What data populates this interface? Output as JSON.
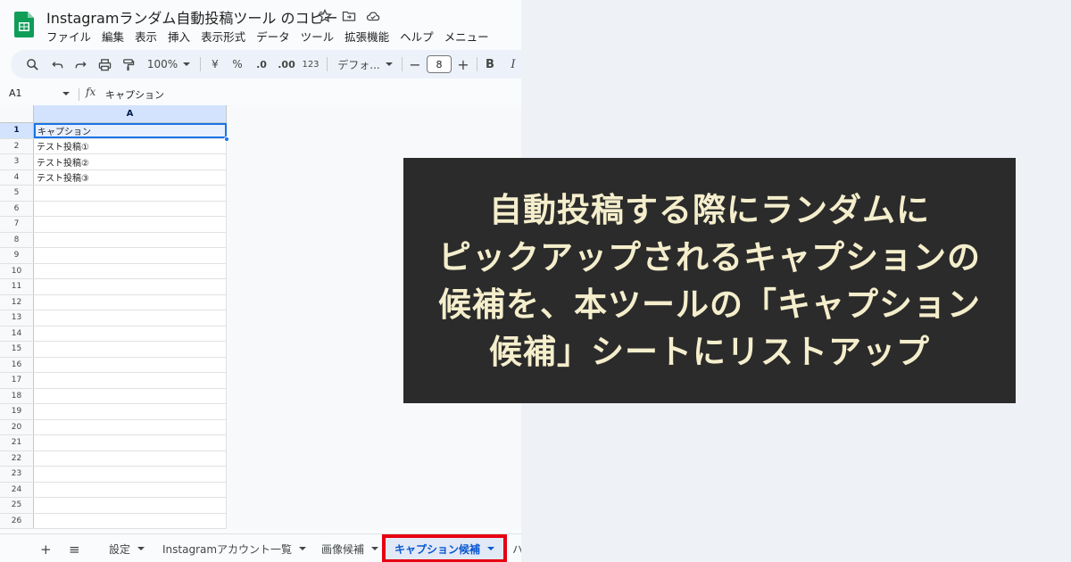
{
  "colors": {
    "accent_blue": "#1a73e8",
    "active_tab_text": "#0b57d0",
    "highlight_red": "#e60012",
    "panel_bg": "#2b2b2b",
    "panel_text": "#f5eecc"
  },
  "window": {
    "title": "Instagramランダム自動投稿ツール のコピー",
    "title_icons": [
      "star-icon",
      "move-to-folder-icon",
      "cloud-status-icon"
    ]
  },
  "menu": [
    "ファイル",
    "編集",
    "表示",
    "挿入",
    "表示形式",
    "データ",
    "ツール",
    "拡張機能",
    "ヘルプ",
    "メニュー"
  ],
  "toolbar": {
    "zoom": "100%",
    "currency": "¥",
    "percent": "%",
    "decrease_decimal": ".0",
    "increase_decimal": ".00",
    "number_format": "123",
    "font": "デフォ...",
    "font_size": "8",
    "minus": "−",
    "plus": "+",
    "bold": "B",
    "italic": "I"
  },
  "formula_bar": {
    "cell_ref": "A1",
    "fx": "fx",
    "content": "キャプション"
  },
  "grid": {
    "column_header": "A",
    "rows": [
      {
        "n": "1",
        "value": "キャプション"
      },
      {
        "n": "2",
        "value": "テスト投稿①"
      },
      {
        "n": "3",
        "value": "テスト投稿②"
      },
      {
        "n": "4",
        "value": "テスト投稿③"
      },
      {
        "n": "5",
        "value": ""
      },
      {
        "n": "6",
        "value": ""
      },
      {
        "n": "7",
        "value": ""
      },
      {
        "n": "8",
        "value": ""
      },
      {
        "n": "9",
        "value": ""
      },
      {
        "n": "10",
        "value": ""
      },
      {
        "n": "11",
        "value": ""
      },
      {
        "n": "12",
        "value": ""
      },
      {
        "n": "13",
        "value": ""
      },
      {
        "n": "14",
        "value": ""
      },
      {
        "n": "15",
        "value": ""
      },
      {
        "n": "16",
        "value": ""
      },
      {
        "n": "17",
        "value": ""
      },
      {
        "n": "18",
        "value": ""
      },
      {
        "n": "19",
        "value": ""
      },
      {
        "n": "20",
        "value": ""
      },
      {
        "n": "21",
        "value": ""
      },
      {
        "n": "22",
        "value": ""
      },
      {
        "n": "23",
        "value": ""
      },
      {
        "n": "24",
        "value": ""
      },
      {
        "n": "25",
        "value": ""
      },
      {
        "n": "26",
        "value": ""
      }
    ]
  },
  "tabs": {
    "add": "+",
    "list": "≡",
    "items": [
      {
        "label": "設定"
      },
      {
        "label": "Instagramアカウント一覧"
      },
      {
        "label": "画像候補"
      },
      {
        "label": "キャプション候補",
        "active": true
      },
      {
        "label": "ハ"
      }
    ]
  },
  "caption_panel": {
    "lines": [
      "自動投稿する際にランダムに",
      "ピックアップされるキャプションの",
      "候補を、本ツールの「キャプション",
      "候補」シートにリストアップ"
    ]
  }
}
